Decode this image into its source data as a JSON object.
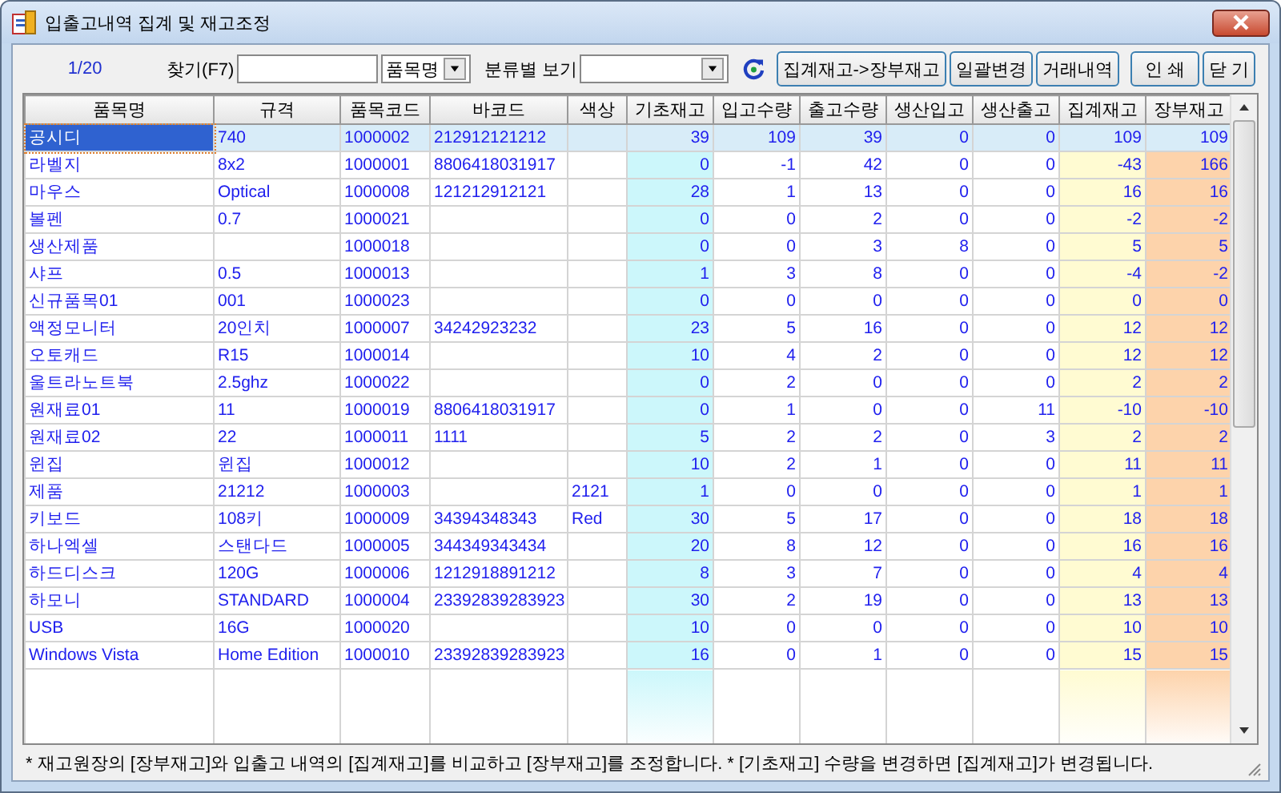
{
  "window": {
    "title": "입출고내역 집계 및 재고조정"
  },
  "toolbar": {
    "page": "1/20",
    "find_label": "찾기(F7)",
    "find_field": "품목명",
    "filter_label": "분류별 보기",
    "buttons": [
      "집계재고->장부재고",
      "일괄변경",
      "거래내역",
      "인 쇄",
      "닫 기"
    ]
  },
  "table": {
    "columns": [
      {
        "label": "품목명",
        "kind": "text"
      },
      {
        "label": "규격",
        "kind": "text"
      },
      {
        "label": "품목코드",
        "kind": "text"
      },
      {
        "label": "바코드",
        "kind": "text"
      },
      {
        "label": "색상",
        "kind": "text"
      },
      {
        "label": "기초재고",
        "kind": "number",
        "color": "#ccf7fb"
      },
      {
        "label": "입고수량",
        "kind": "number"
      },
      {
        "label": "출고수량",
        "kind": "number"
      },
      {
        "label": "생산입고",
        "kind": "number"
      },
      {
        "label": "생산출고",
        "kind": "number"
      },
      {
        "label": "집계재고",
        "kind": "number",
        "color": "#fffbd2"
      },
      {
        "label": "장부재고",
        "kind": "number",
        "color": "#fdd3ab"
      }
    ],
    "rows": [
      {
        "selected": true,
        "cells": [
          "공시디",
          "740",
          "1000002",
          "212912121212",
          "",
          "39",
          "109",
          "39",
          "0",
          "0",
          "109",
          "109"
        ]
      },
      {
        "selected": false,
        "cells": [
          "라벨지",
          "8x2",
          "1000001",
          "8806418031917",
          "",
          "0",
          "-1",
          "42",
          "0",
          "0",
          "-43",
          "166"
        ]
      },
      {
        "selected": false,
        "cells": [
          "마우스",
          "Optical",
          "1000008",
          "121212912121",
          "",
          "28",
          "1",
          "13",
          "0",
          "0",
          "16",
          "16"
        ]
      },
      {
        "selected": false,
        "cells": [
          "볼펜",
          "0.7",
          "1000021",
          "",
          "",
          "0",
          "0",
          "2",
          "0",
          "0",
          "-2",
          "-2"
        ]
      },
      {
        "selected": false,
        "cells": [
          "생산제품",
          "",
          "1000018",
          "",
          "",
          "0",
          "0",
          "3",
          "8",
          "0",
          "5",
          "5"
        ]
      },
      {
        "selected": false,
        "cells": [
          "샤프",
          "0.5",
          "1000013",
          "",
          "",
          "1",
          "3",
          "8",
          "0",
          "0",
          "-4",
          "-2"
        ]
      },
      {
        "selected": false,
        "cells": [
          "신규품목01",
          "001",
          "1000023",
          "",
          "",
          "0",
          "0",
          "0",
          "0",
          "0",
          "0",
          "0"
        ]
      },
      {
        "selected": false,
        "cells": [
          "액정모니터",
          "20인치",
          "1000007",
          "34242923232",
          "",
          "23",
          "5",
          "16",
          "0",
          "0",
          "12",
          "12"
        ]
      },
      {
        "selected": false,
        "cells": [
          "오토캐드",
          "R15",
          "1000014",
          "",
          "",
          "10",
          "4",
          "2",
          "0",
          "0",
          "12",
          "12"
        ]
      },
      {
        "selected": false,
        "cells": [
          "울트라노트북",
          "2.5ghz",
          "1000022",
          "",
          "",
          "0",
          "2",
          "0",
          "0",
          "0",
          "2",
          "2"
        ]
      },
      {
        "selected": false,
        "cells": [
          "원재료01",
          "11",
          "1000019",
          "8806418031917",
          "",
          "0",
          "1",
          "0",
          "0",
          "11",
          "-10",
          "-10"
        ]
      },
      {
        "selected": false,
        "cells": [
          "원재료02",
          "22",
          "1000011",
          "1111",
          "",
          "5",
          "2",
          "2",
          "0",
          "3",
          "2",
          "2"
        ]
      },
      {
        "selected": false,
        "cells": [
          "윈집",
          "윈집",
          "1000012",
          "",
          "",
          "10",
          "2",
          "1",
          "0",
          "0",
          "11",
          "11"
        ]
      },
      {
        "selected": false,
        "cells": [
          "제품",
          "21212",
          "1000003",
          "",
          "2121",
          "1",
          "0",
          "0",
          "0",
          "0",
          "1",
          "1"
        ]
      },
      {
        "selected": false,
        "cells": [
          "키보드",
          "108키",
          "1000009",
          "34394348343",
          "Red",
          "30",
          "5",
          "17",
          "0",
          "0",
          "18",
          "18"
        ]
      },
      {
        "selected": false,
        "cells": [
          "하나엑셀",
          "스탠다드",
          "1000005",
          "344349343434",
          "",
          "20",
          "8",
          "12",
          "0",
          "0",
          "16",
          "16"
        ]
      },
      {
        "selected": false,
        "cells": [
          "하드디스크",
          "120G",
          "1000006",
          "1212918891212",
          "",
          "8",
          "3",
          "7",
          "0",
          "0",
          "4",
          "4"
        ]
      },
      {
        "selected": false,
        "cells": [
          "하모니",
          "STANDARD",
          "1000004",
          "23392839283923",
          "",
          "30",
          "2",
          "19",
          "0",
          "0",
          "13",
          "13"
        ]
      },
      {
        "selected": false,
        "cells": [
          "USB",
          "16G",
          "1000020",
          "",
          "",
          "10",
          "0",
          "0",
          "0",
          "0",
          "10",
          "10"
        ]
      },
      {
        "selected": false,
        "cells": [
          "Windows Vista",
          "Home Edition",
          "1000010",
          "23392839283923",
          "",
          "16",
          "0",
          "1",
          "0",
          "0",
          "15",
          "15"
        ]
      }
    ]
  },
  "status_bar": "* 재고원장의 [장부재고]와 입출고 내역의 [집계재고]를 비교하고 [장부재고]를 조정합니다. * [기초재고] 수량을 변경하면 [집계재고]가 변경됩니다."
}
